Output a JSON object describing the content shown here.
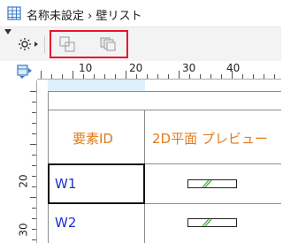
{
  "window": {
    "title": "名称未設定 › 壁リスト"
  },
  "ruler": {
    "top_labels": [
      "10",
      "20",
      "30",
      "40"
    ],
    "left_labels": [
      "20",
      "30"
    ]
  },
  "table": {
    "headers": {
      "element_id": "要素ID",
      "preview": "2D平面 プレビュー"
    },
    "rows": [
      {
        "id": "W1"
      },
      {
        "id": "W2"
      }
    ]
  },
  "colors": {
    "highlight": "#e8132b",
    "header_text": "#e07b1b",
    "id_text": "#1a2fd0"
  }
}
